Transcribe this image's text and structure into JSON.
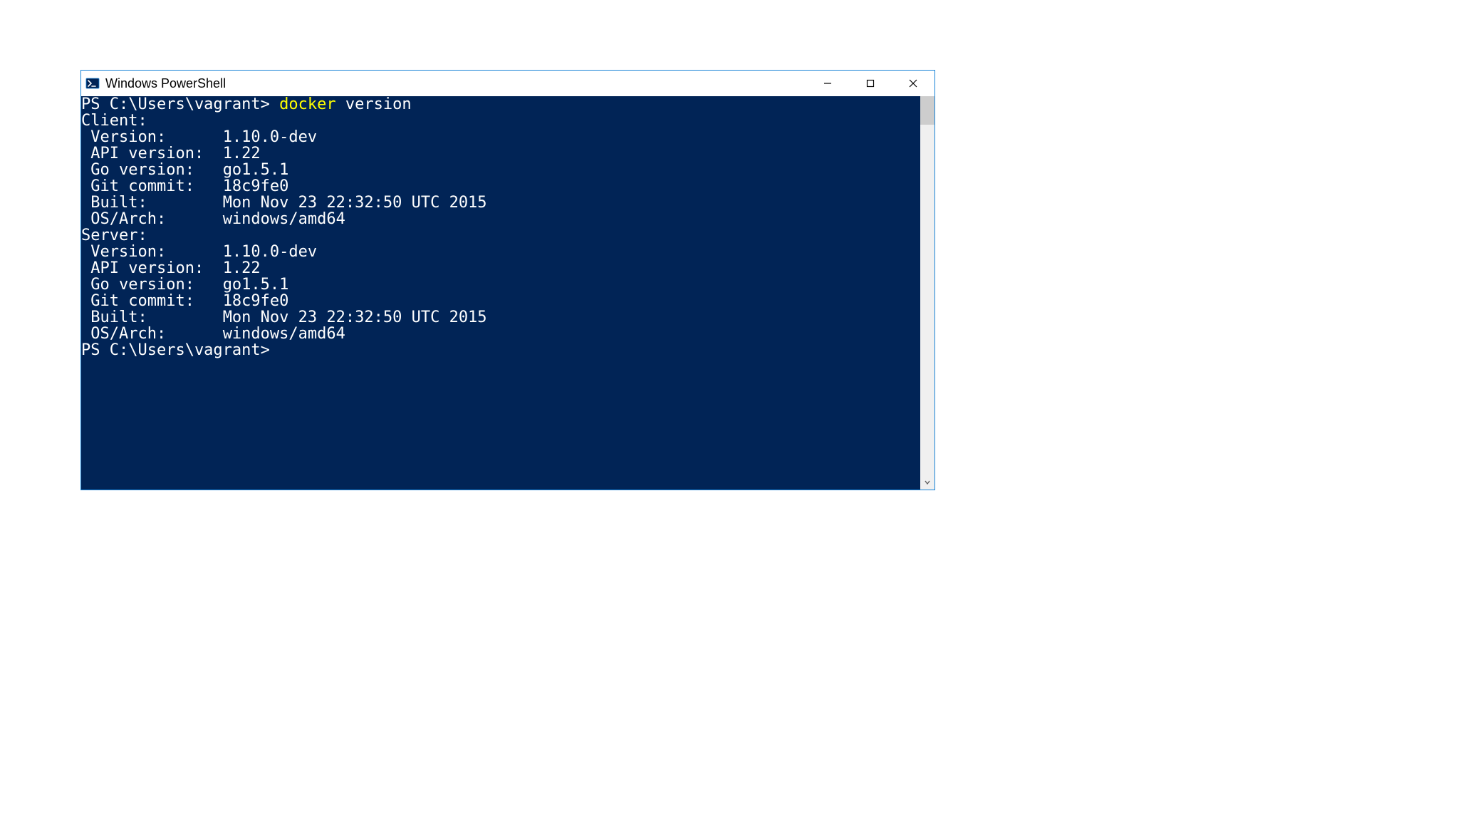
{
  "window": {
    "title": "Windows PowerShell"
  },
  "terminal": {
    "prompt1_prefix": "PS C:\\Users\\vagrant> ",
    "prompt1_cmd_highlight": "docker",
    "prompt1_cmd_rest": " version",
    "output": {
      "client_header": "Client:",
      "client_version_label": " Version:      ",
      "client_version_value": "1.10.0-dev",
      "client_api_label": " API version:  ",
      "client_api_value": "1.22",
      "client_go_label": " Go version:   ",
      "client_go_value": "go1.5.1",
      "client_git_label": " Git commit:   ",
      "client_git_value": "18c9fe0",
      "client_built_label": " Built:        ",
      "client_built_value": "Mon Nov 23 22:32:50 UTC 2015",
      "client_os_label": " OS/Arch:      ",
      "client_os_value": "windows/amd64",
      "blank": "",
      "server_header": "Server:",
      "server_version_label": " Version:      ",
      "server_version_value": "1.10.0-dev",
      "server_api_label": " API version:  ",
      "server_api_value": "1.22",
      "server_go_label": " Go version:   ",
      "server_go_value": "go1.5.1",
      "server_git_label": " Git commit:   ",
      "server_git_value": "18c9fe0",
      "server_built_label": " Built:        ",
      "server_built_value": "Mon Nov 23 22:32:50 UTC 2015",
      "server_os_label": " OS/Arch:      ",
      "server_os_value": "windows/amd64"
    },
    "prompt2": "PS C:\\Users\\vagrant>"
  }
}
